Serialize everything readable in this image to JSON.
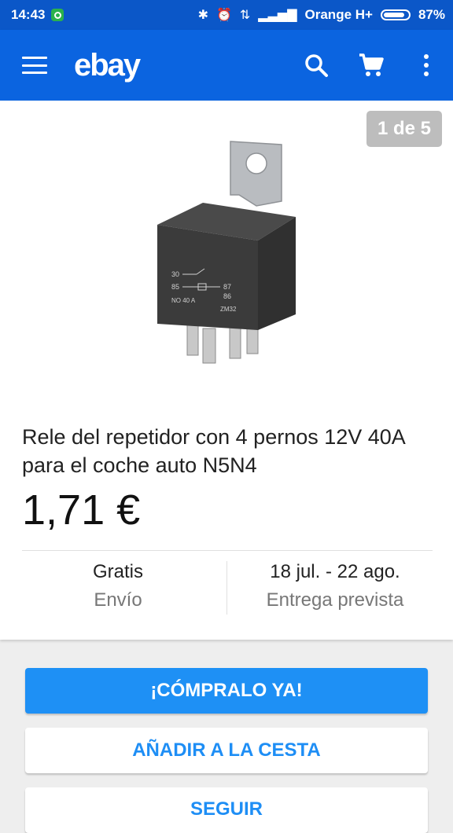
{
  "status_bar": {
    "time": "14:43",
    "carrier": "Orange H+",
    "battery": "87%",
    "battery_level": 0.87
  },
  "app_bar": {
    "logo": "ebay",
    "icons": [
      "menu-icon",
      "search-icon",
      "cart-icon",
      "more-vert-icon"
    ]
  },
  "gallery": {
    "counter": "1 de 5"
  },
  "product": {
    "title": "Rele del repetidor con 4 pernos 12V 40A para el coche auto N5N4",
    "price": "1,71 €"
  },
  "relay_label": {
    "pin30": "30",
    "pin85": "85",
    "pin87": "87",
    "pin86": "86",
    "rating": "NO  40 A",
    "model": "ZM32"
  },
  "shipping": {
    "cost_value": "Gratis",
    "cost_label": "Envío",
    "delivery_value": "18 jul. - 22 ago.",
    "delivery_label": "Entrega prevista"
  },
  "actions": {
    "buy_now": "¡CÓMPRALO YA!",
    "add_to_cart": "AÑADIR A LA CESTA",
    "follow": "SEGUIR"
  },
  "colors": {
    "status_bar": "#0b57c8",
    "app_bar": "#0b64e0",
    "primary_button": "#1e90f5",
    "accent_text": "#1e8ef5"
  }
}
